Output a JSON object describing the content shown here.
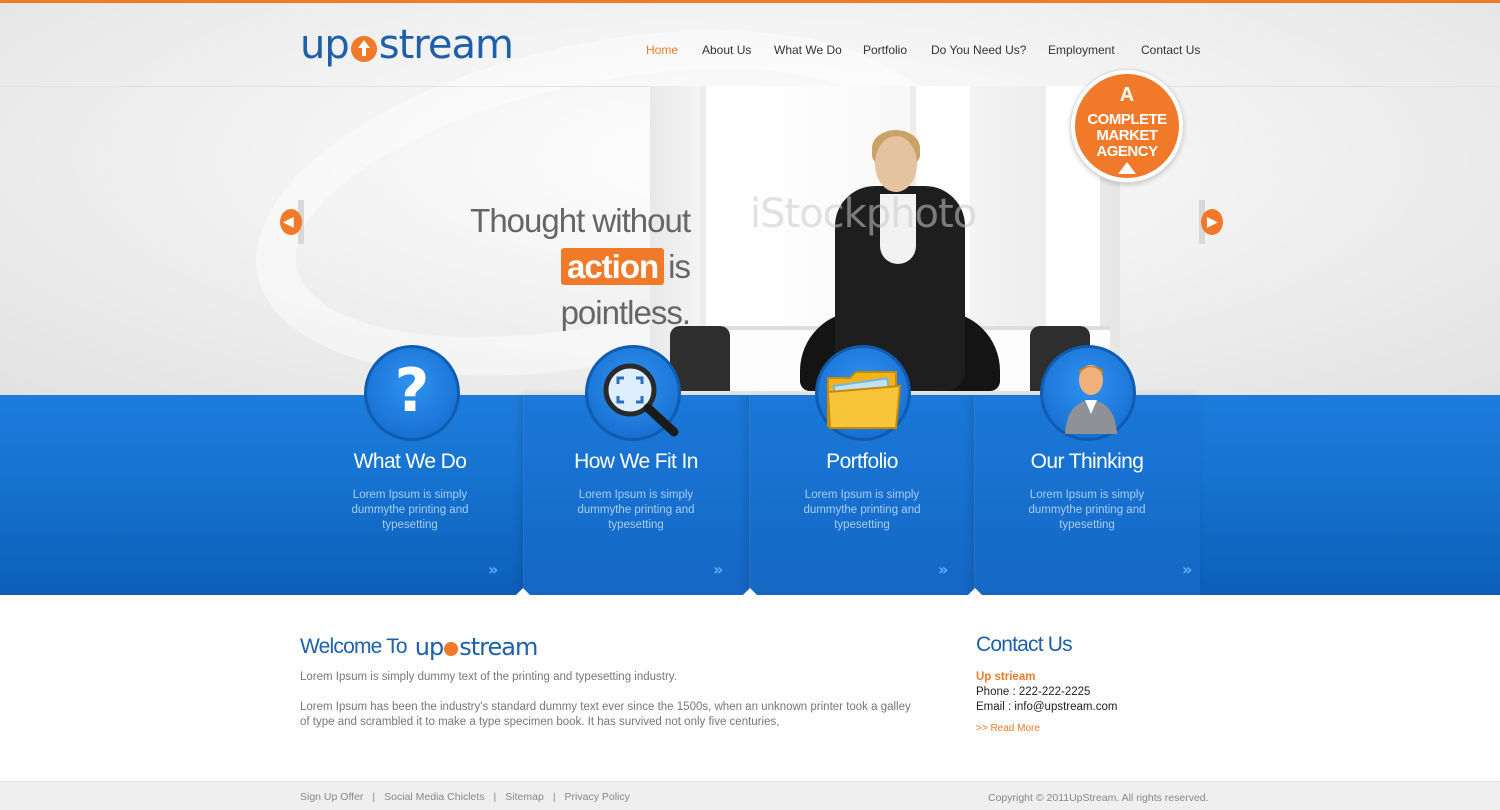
{
  "header": {
    "logo_text_left": "up",
    "logo_text_right": "stream",
    "nav": [
      {
        "label": "Home",
        "active": true
      },
      {
        "label": "About Us",
        "active": false
      },
      {
        "label": "What We Do",
        "active": false
      },
      {
        "label": "Portfolio",
        "active": false
      },
      {
        "label": "Do You Need Us?",
        "active": false
      },
      {
        "label": "Employment",
        "active": false
      },
      {
        "label": "Contact Us",
        "active": false
      }
    ]
  },
  "slider": {
    "line1": "Thought without",
    "highlight": "action",
    "line2_rest": "is pointless.",
    "watermark": "iStockphoto",
    "badge_line1": "A",
    "badge_line2": "COMPLETE",
    "badge_line3": "MARKET",
    "badge_line4": "AGENCY",
    "prev_icon": "chevron-left-icon",
    "next_icon": "chevron-right-icon"
  },
  "features": [
    {
      "title": "What We Do",
      "text": "Lorem Ipsum is simply dummythe printing and typesetting",
      "icon": "question-mark-icon"
    },
    {
      "title": "How We Fit In",
      "text": "Lorem Ipsum is simply dummythe printing and typesetting",
      "icon": "magnifier-icon"
    },
    {
      "title": "Portfolio",
      "text": "Lorem Ipsum is simply dummythe printing and typesetting",
      "icon": "folder-icon"
    },
    {
      "title": "Our Thinking",
      "text": "Lorem Ipsum is simply dummythe printing and typesetting",
      "icon": "user-icon"
    }
  ],
  "more_glyph": "»",
  "welcome": {
    "title_prefix": "Welcome To",
    "logo_left": "up",
    "logo_right": "stream",
    "para1": "Lorem Ipsum is simply dummy text of the printing and typesetting industry.",
    "para2": "Lorem Ipsum has been the industry's standard dummy text ever since the 1500s, when an unknown printer took a galley of type and scrambled it to make a type specimen book. It has survived not only five centuries,"
  },
  "contact": {
    "title": "Contact Us",
    "name": "Up strieam",
    "phone": "Phone : 222-222-2225",
    "email": "Email : info@upstream.com",
    "read_more": ">> Read More"
  },
  "footer": {
    "links": [
      "Sign Up Offer",
      "Social Media Chiclets",
      "Sitemap",
      "Privacy Policy"
    ],
    "separator": "|",
    "copyright": "Copyright © 2011UpStream. All rights reserved."
  },
  "colors": {
    "accent": "#f07a2a",
    "brand_blue": "#1d5fa8",
    "band_blue": "#1673d1"
  }
}
